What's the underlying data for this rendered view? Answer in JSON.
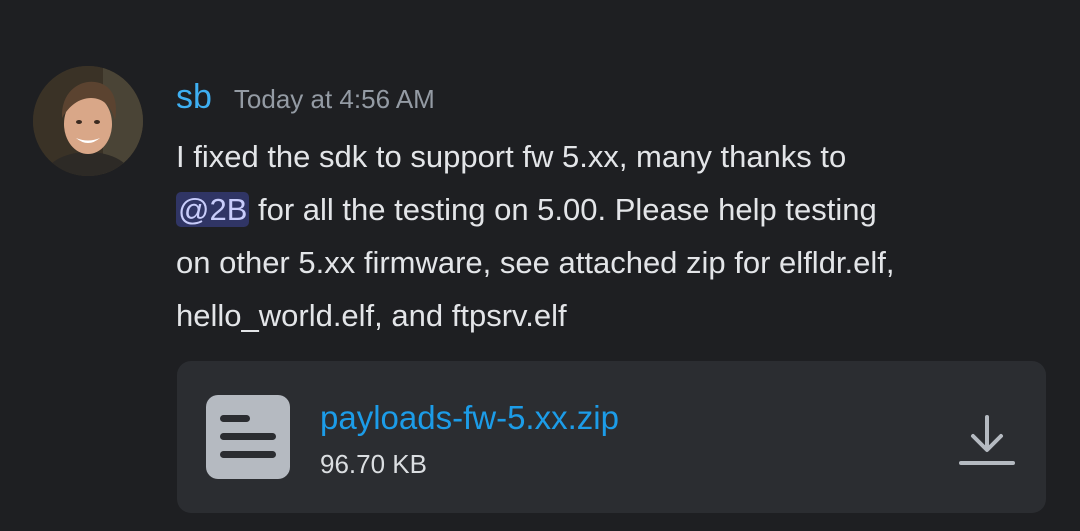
{
  "message": {
    "author": "sb",
    "timestamp": "Today at 4:56 AM",
    "content": {
      "line1": "I fixed the sdk to support fw 5.xx, many thanks to",
      "mention": "@2B",
      "line2_rest": " for all the testing on 5.00. Please help testing",
      "line3": "on other 5.xx firmware, see attached zip for elfldr.elf,",
      "line4": "hello_world.elf, and ftpsrv.elf"
    },
    "attachment": {
      "filename": "payloads-fw-5.xx.zip",
      "size": "96.70 KB",
      "icon": "document-icon",
      "action_icon": "download-icon"
    }
  },
  "colors": {
    "background": "#1e1f22",
    "username": "#3eaff2",
    "link": "#1c9ce8",
    "attachment_bg": "#2b2d31",
    "mention_bg": "rgba(88,101,242,0.32)"
  }
}
